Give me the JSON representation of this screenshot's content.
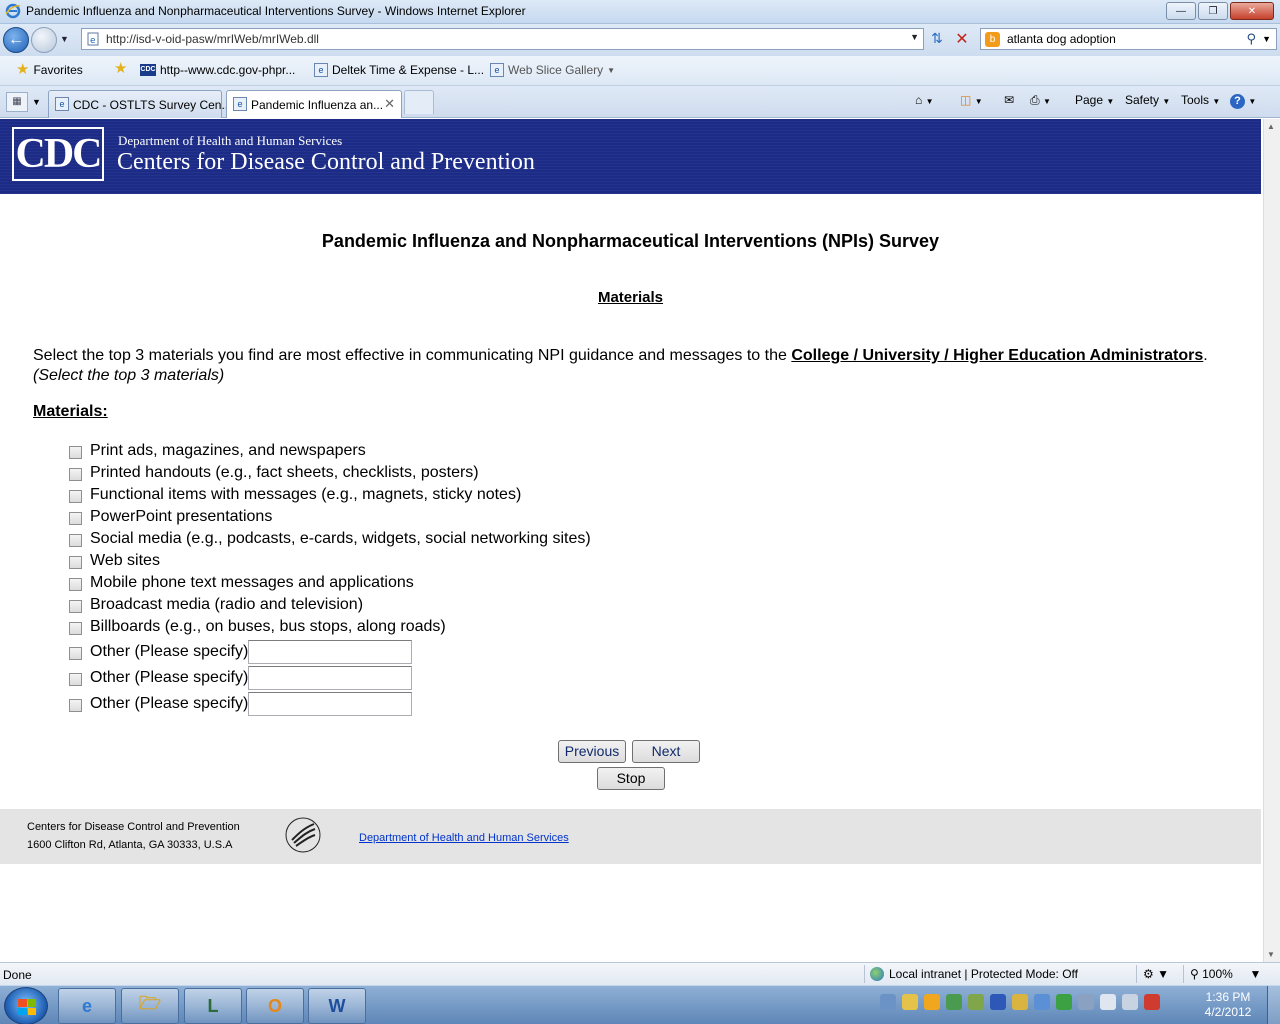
{
  "window": {
    "title": "Pandemic Influenza and Nonpharmaceutical Interventions Survey - Windows Internet Explorer"
  },
  "nav": {
    "url": "http://isd-v-oid-pasw/mrIWeb/mrIWeb.dll",
    "search_query": "atlanta dog adoption"
  },
  "favorites": {
    "label": "Favorites",
    "items": [
      {
        "label": "http--www.cdc.gov-phpr..."
      },
      {
        "label": "Deltek Time & Expense - L..."
      },
      {
        "label": "Web Slice Gallery"
      }
    ]
  },
  "tabs": [
    {
      "label": "CDC - OSTLTS Survey Cen..."
    },
    {
      "label": "Pandemic Influenza an..."
    }
  ],
  "commandbar": {
    "page": "Page",
    "safety": "Safety",
    "tools": "Tools"
  },
  "banner": {
    "logo": "CDC",
    "dept": "Department of Health and Human Services",
    "centers": "Centers for Disease Control and Prevention"
  },
  "survey": {
    "title": "Pandemic Influenza and Nonpharmaceutical Interventions (NPIs) Survey",
    "section": "Materials",
    "question_pre": "Select the top 3 materials you find are most effective in communicating NPI guidance and messages to the ",
    "question_audience": "College / University / Higher Education Administrators",
    "question_post": ".",
    "hint": "(Select the top 3 materials)",
    "materials_label": "Materials:",
    "options": [
      "Print ads, magazines, and newspapers",
      "Printed handouts (e.g., fact sheets, checklists, posters)",
      "Functional items with messages (e.g., magnets, sticky notes)",
      "PowerPoint presentations",
      "Social media (e.g., podcasts, e-cards, widgets, social networking sites)",
      "Web sites",
      "Mobile phone text messages and applications",
      "Broadcast media (radio and television)",
      "Billboards (e.g., on buses, bus stops, along roads)"
    ],
    "other_label": "Other (Please specify)",
    "buttons": {
      "previous": "Previous",
      "next": "Next",
      "stop": "Stop"
    }
  },
  "footer": {
    "org": "Centers for Disease Control and Prevention",
    "address": "1600 Clifton Rd, Atlanta, GA 30333, U.S.A",
    "hhs_link": "Department of Health and Human Services"
  },
  "status": {
    "text": "Done",
    "zone": "Local intranet | Protected Mode: Off",
    "zoom": "100%"
  },
  "taskbar": {
    "time": "1:36 PM",
    "date": "4/2/2012"
  },
  "colors": {
    "banner": "#1b2b86",
    "link": "#0033cc",
    "footer_bg": "#e4e4e4"
  }
}
